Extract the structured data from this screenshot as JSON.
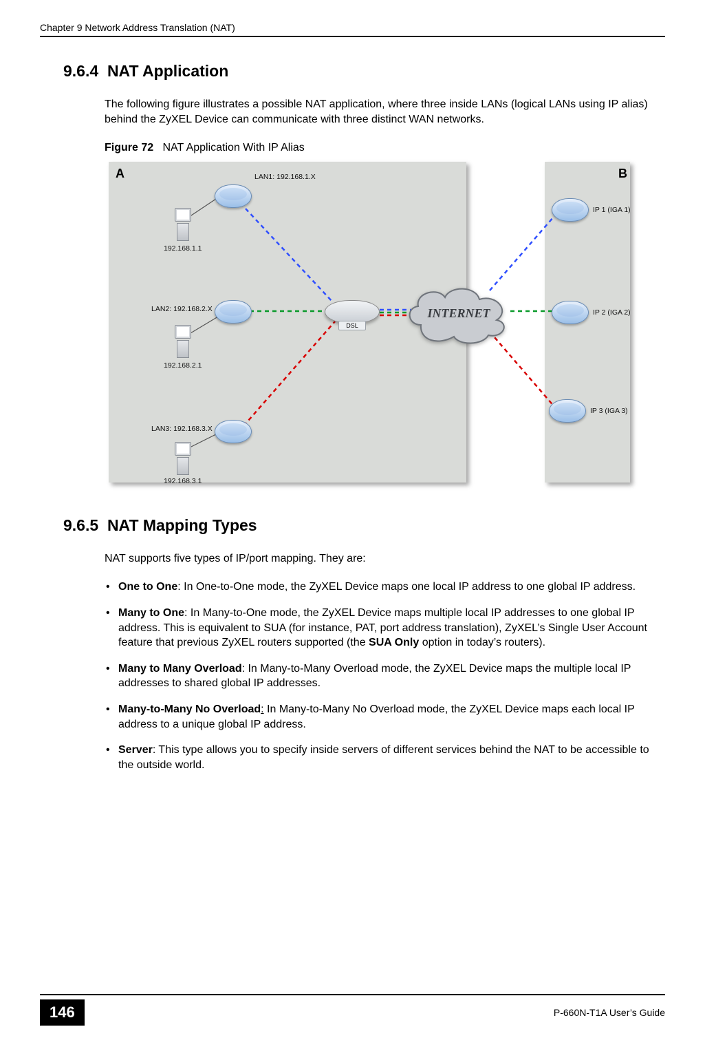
{
  "header": {
    "running_head": "Chapter 9 Network Address Translation (NAT)"
  },
  "sections": {
    "nat_app": {
      "number": "9.6.4",
      "title": "NAT Application",
      "intro": "The following figure illustrates a possible NAT application, where three inside LANs (logical LANs using IP alias) behind the ZyXEL Device can communicate with three distinct WAN networks."
    },
    "figure": {
      "label": "Figure 72",
      "caption": "NAT Application With IP Alias",
      "corner_a": "A",
      "corner_b": "B",
      "lan1_label": "LAN1: 192.168.1.X",
      "lan1_host": "192.168.1.1",
      "lan2_label": "LAN2: 192.168.2.X",
      "lan2_host": "192.168.2.1",
      "lan3_label": "LAN3: 192.168.3.X",
      "lan3_host": "192.168.3.1",
      "dsl_tag": "DSL",
      "cloud_label": "INTERNET",
      "ip1": "IP 1 (IGA 1)",
      "ip2": "IP 2 (IGA 2)",
      "ip3": "IP 3 (IGA 3)"
    },
    "mapping": {
      "number": "9.6.5",
      "title": "NAT Mapping Types",
      "intro": "NAT supports five types of IP/port mapping. They are:",
      "items": [
        {
          "name": "One to One",
          "text_a": ": In One-to-One mode, the ZyXEL Device maps one local IP address to one global IP address."
        },
        {
          "name": "Many to One",
          "text_a": ": In Many-to-One mode, the ZyXEL Device maps multiple local IP addresses to one global IP address. This is equivalent to SUA (for instance, PAT, port address translation), ZyXEL’s Single User Account feature that previous ZyXEL routers supported (the ",
          "bold_mid": "SUA Only",
          "text_b": " option in today’s routers)."
        },
        {
          "name": "Many to Many Overload",
          "text_a": ": In Many-to-Many Overload mode, the ZyXEL Device maps the multiple local IP addresses to shared global IP addresses."
        },
        {
          "name": "Many-to-Many No Overload",
          "underline_colon": true,
          "text_a": " In Many-to-Many No Overload mode, the ZyXEL Device maps each local IP address to a unique global IP address."
        },
        {
          "name": "Server",
          "text_a": ": This type allows you to specify inside servers of different services behind the NAT to be accessible to the outside world."
        }
      ]
    }
  },
  "footer": {
    "page_number": "146",
    "guide": "P-660N-T1A User’s Guide"
  }
}
